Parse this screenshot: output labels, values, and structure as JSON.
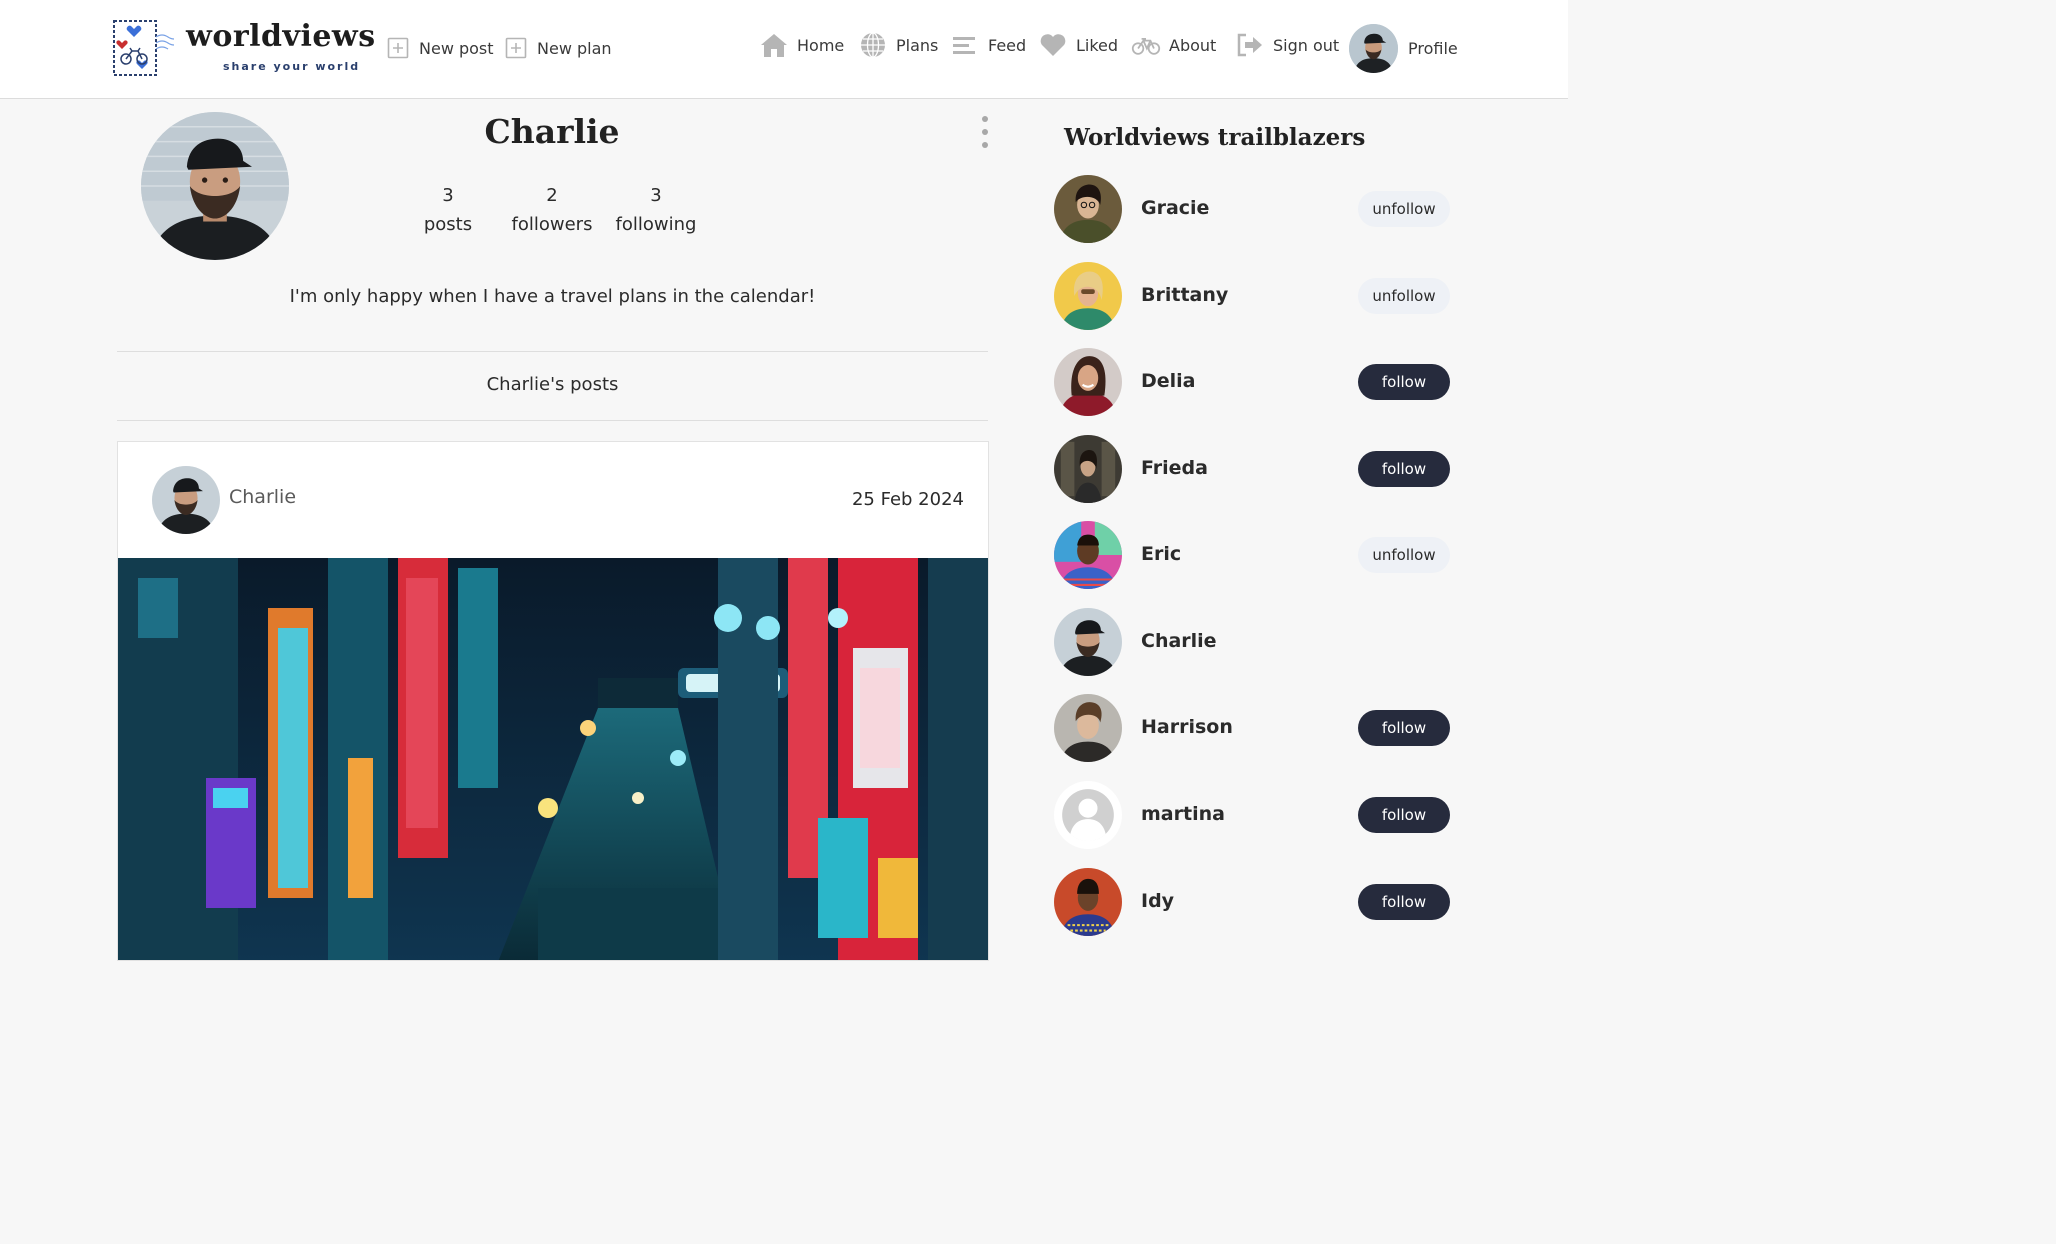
{
  "navbar": {
    "brand_name": "worldviews",
    "brand_tagline": "share your world",
    "new_post_label": "New post",
    "new_plan_label": "New plan",
    "home_label": "Home",
    "plans_label": "Plans",
    "feed_label": "Feed",
    "liked_label": "Liked",
    "about_label": "About",
    "signout_label": "Sign out",
    "profile_label": "Profile"
  },
  "profile": {
    "name": "Charlie",
    "stats": {
      "posts_count": "3",
      "posts_label": "posts",
      "followers_count": "2",
      "followers_label": "followers",
      "following_count": "3",
      "following_label": "following"
    },
    "bio": "I'm only happy when I have a travel plans in the calendar!",
    "posts_heading": "Charlie's posts"
  },
  "post": {
    "author": "Charlie",
    "date": "25 Feb 2024"
  },
  "sidebar": {
    "title": "Worldviews trailblazers",
    "users": [
      {
        "name": "Gracie",
        "action": "unfollow"
      },
      {
        "name": "Brittany",
        "action": "unfollow"
      },
      {
        "name": "Delia",
        "action": "follow"
      },
      {
        "name": "Frieda",
        "action": "follow"
      },
      {
        "name": "Eric",
        "action": "unfollow"
      },
      {
        "name": "Charlie",
        "action": ""
      },
      {
        "name": "Harrison",
        "action": "follow"
      },
      {
        "name": "martina",
        "action": "follow"
      },
      {
        "name": "Idy",
        "action": "follow"
      }
    ]
  },
  "colors": {
    "accent_dark": "#262b3d",
    "unfollow_bg": "#eef1f6",
    "brand_blue": "#2a3f6d",
    "icon_gray": "#b5b5b5"
  },
  "icons": {
    "new_post": "plus-square-icon",
    "new_plan": "plus-square-icon",
    "home": "home-icon",
    "plans": "globe-icon",
    "feed": "list-icon",
    "liked": "heart-icon",
    "about": "bicycle-icon",
    "signout": "sign-out-icon",
    "post_more": "kebab-menu-icon"
  }
}
